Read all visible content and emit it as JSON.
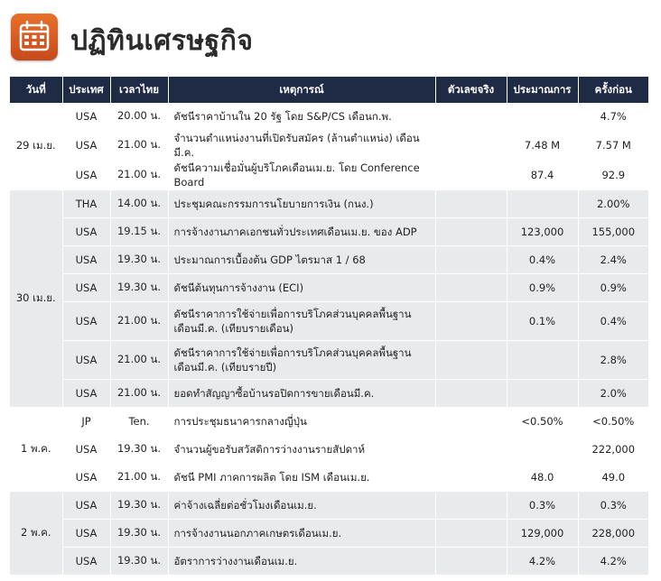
{
  "page": {
    "title": "ปฏิทินเศรษฐกิจ",
    "icon": "calendar-icon",
    "colors": {
      "header_bg": "#1f2a44",
      "icon_orange": "#d85a22",
      "row_shade": "#e9eaec"
    }
  },
  "table": {
    "headers": {
      "date": "วันที่",
      "country": "ประเทศ",
      "time": "เวลาไทย",
      "event": "เหตุการณ์",
      "actual": "ตัวเลขจริง",
      "forecast": "ประมาณการ",
      "previous": "ครั้งก่อน"
    },
    "groups": [
      {
        "date": "29 เม.ย.",
        "rows": [
          {
            "country": "USA",
            "time": "20.00 น.",
            "event": "ดัชนีราคาบ้านใน 20 รัฐ โดย S&P/CS เดือนก.พ.",
            "actual": "",
            "forecast": "",
            "previous": "4.7%"
          },
          {
            "country": "USA",
            "time": "21.00 น.",
            "event": "จำนวนตำแหน่งงานที่เปิดรับสมัคร (ล้านตำแหน่ง) เดือนมี.ค.",
            "actual": "",
            "forecast": "7.48 M",
            "previous": "7.57 M"
          },
          {
            "country": "USA",
            "time": "21.00 น.",
            "event": "ดัชนีความเชื่อมั่นผู้บริโภคเดือนเม.ย. โดย Conference Board",
            "actual": "",
            "forecast": "87.4",
            "previous": "92.9"
          }
        ]
      },
      {
        "date": "30 เม.ย.",
        "rows": [
          {
            "country": "THA",
            "time": "14.00 น.",
            "event": "ประชุมคณะกรรมการนโยบายการเงิน (กนง.)",
            "actual": "",
            "forecast": "",
            "previous": "2.00%"
          },
          {
            "country": "USA",
            "time": "19.15 น.",
            "event": "การจ้างงานภาคเอกชนทั่วประเทศเดือนเม.ย. ของ ADP",
            "actual": "",
            "forecast": "123,000",
            "previous": "155,000"
          },
          {
            "country": "USA",
            "time": "19.30 น.",
            "event": "ประมาณการเบื้องต้น GDP ไตรมาส 1 / 68",
            "actual": "",
            "forecast": "0.4%",
            "previous": "2.4%"
          },
          {
            "country": "USA",
            "time": "19.30 น.",
            "event": "ดัชนีต้นทุนการจ้างงาน (ECI)",
            "actual": "",
            "forecast": "0.9%",
            "previous": "0.9%"
          },
          {
            "country": "USA",
            "time": "21.00 น.",
            "event": "ดัชนีราคาการใช้จ่ายเพื่อการบริโภคส่วนบุคคลพื้นฐาน เดือนมี.ค. (เทียบรายเดือน)",
            "actual": "",
            "forecast": "0.1%",
            "previous": "0.4%"
          },
          {
            "country": "USA",
            "time": "21.00 น.",
            "event": "ดัชนีราคาการใช้จ่ายเพื่อการบริโภคส่วนบุคคลพื้นฐาน เดือนมี.ค. (เทียบรายปี)",
            "actual": "",
            "forecast": "",
            "previous": "2.8%"
          },
          {
            "country": "USA",
            "time": "21.00 น.",
            "event": "ยอดทำสัญญาซื้อบ้านรอปิดการขายเดือนมี.ค.",
            "actual": "",
            "forecast": "",
            "previous": "2.0%"
          }
        ]
      },
      {
        "date": "1 พ.ค.",
        "rows": [
          {
            "country": "JP",
            "time": "Ten.",
            "event": "การประชุมธนาคารกลางญี่ปุ่น",
            "actual": "",
            "forecast": "<0.50%",
            "previous": "<0.50%"
          },
          {
            "country": "USA",
            "time": "19.30 น.",
            "event": "จำนวนผู้ขอรับสวัสดิการว่างงานรายสัปดาห์",
            "actual": "",
            "forecast": "",
            "previous": "222,000"
          },
          {
            "country": "USA",
            "time": "21.00 น.",
            "event": "ดัชนี PMI ภาคการผลิต โดย ISM เดือนเม.ย.",
            "actual": "",
            "forecast": "48.0",
            "previous": "49.0"
          }
        ]
      },
      {
        "date": "2 พ.ค.",
        "rows": [
          {
            "country": "USA",
            "time": "19.30 น.",
            "event": "ค่าจ้างเฉลี่ยต่อชั่วโมงเดือนเม.ย.",
            "actual": "",
            "forecast": "0.3%",
            "previous": "0.3%"
          },
          {
            "country": "USA",
            "time": "19.30 น.",
            "event": "การจ้างงานนอกภาคเกษตรเดือนเม.ย.",
            "actual": "",
            "forecast": "129,000",
            "previous": "228,000"
          },
          {
            "country": "USA",
            "time": "19.30 น.",
            "event": "อัตราการว่างงานเดือนเม.ย.",
            "actual": "",
            "forecast": "4.2%",
            "previous": "4.2%"
          }
        ]
      }
    ]
  }
}
